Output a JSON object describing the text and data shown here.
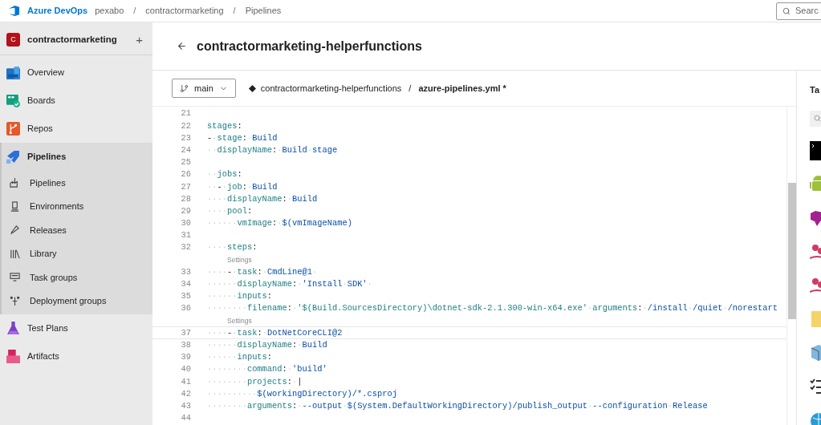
{
  "top_bar": {
    "brand": "Azure DevOps",
    "breadcrumbs": [
      "pexabo",
      "contractormarketing",
      "Pipelines"
    ],
    "separator": "/",
    "search": {
      "placeholder": "Searc"
    }
  },
  "sidebar": {
    "project": {
      "initial": "C",
      "name": "contractormarketing",
      "add": "+"
    },
    "items": [
      {
        "label": "Overview",
        "selected": false
      },
      {
        "label": "Boards",
        "selected": false
      },
      {
        "label": "Repos",
        "selected": false
      },
      {
        "label": "Pipelines",
        "selected": true,
        "expanded": true,
        "children": [
          {
            "label": "Pipelines"
          },
          {
            "label": "Environments"
          },
          {
            "label": "Releases"
          },
          {
            "label": "Library"
          },
          {
            "label": "Task groups"
          },
          {
            "label": "Deployment groups"
          }
        ]
      },
      {
        "label": "Test Plans",
        "selected": false
      },
      {
        "label": "Artifacts",
        "selected": false
      }
    ]
  },
  "page": {
    "title": "contractormarketing-helperfunctions",
    "branch": "main",
    "repo": "contractormarketing-helperfunctions",
    "separator": "/",
    "file": "azure-pipelines.yml *"
  },
  "editor": {
    "lines": [
      {
        "number": "21"
      },
      {
        "number": "22",
        "tokens": [
          {
            "kind": "key",
            "text": "stages"
          },
          {
            "kind": "punct",
            "text": ":"
          }
        ]
      },
      {
        "number": "23",
        "tokens": [
          {
            "kind": "punct",
            "text": "-"
          },
          {
            "kind": "ws",
            "text": "·"
          },
          {
            "kind": "key",
            "text": "stage"
          },
          {
            "kind": "punct",
            "text": ":"
          },
          {
            "kind": "ws",
            "text": "·"
          },
          {
            "kind": "val",
            "text": "Build"
          }
        ]
      },
      {
        "number": "24",
        "tokens": [
          {
            "kind": "ws",
            "text": "··"
          },
          {
            "kind": "key",
            "text": "displayName"
          },
          {
            "kind": "punct",
            "text": ":"
          },
          {
            "kind": "ws",
            "text": "·"
          },
          {
            "kind": "val",
            "text": "Build"
          },
          {
            "kind": "ws",
            "text": "·"
          },
          {
            "kind": "val",
            "text": "stage"
          }
        ]
      },
      {
        "number": "25"
      },
      {
        "number": "26",
        "tokens": [
          {
            "kind": "ws",
            "text": "··"
          },
          {
            "kind": "key",
            "text": "jobs"
          },
          {
            "kind": "punct",
            "text": ":"
          }
        ]
      },
      {
        "number": "27",
        "tokens": [
          {
            "kind": "ws",
            "text": "··"
          },
          {
            "kind": "punct",
            "text": "-"
          },
          {
            "kind": "ws",
            "text": "·"
          },
          {
            "kind": "key",
            "text": "job"
          },
          {
            "kind": "punct",
            "text": ":"
          },
          {
            "kind": "ws",
            "text": "·"
          },
          {
            "kind": "val",
            "text": "Build"
          }
        ]
      },
      {
        "number": "28",
        "tokens": [
          {
            "kind": "ws",
            "text": "····"
          },
          {
            "kind": "key",
            "text": "displayName"
          },
          {
            "kind": "punct",
            "text": ":"
          },
          {
            "kind": "ws",
            "text": "·"
          },
          {
            "kind": "val",
            "text": "Build"
          }
        ]
      },
      {
        "number": "29",
        "tokens": [
          {
            "kind": "ws",
            "text": "····"
          },
          {
            "kind": "key",
            "text": "pool"
          },
          {
            "kind": "punct",
            "text": ":"
          }
        ]
      },
      {
        "number": "30",
        "tokens": [
          {
            "kind": "ws",
            "text": "······"
          },
          {
            "kind": "key",
            "text": "vmImage"
          },
          {
            "kind": "punct",
            "text": ":"
          },
          {
            "kind": "ws",
            "text": "·"
          },
          {
            "kind": "val",
            "text": "$(vmImageName)"
          }
        ]
      },
      {
        "number": "31"
      },
      {
        "number": "32",
        "tokens": [
          {
            "kind": "ws",
            "text": "····"
          },
          {
            "kind": "key",
            "text": "steps"
          },
          {
            "kind": "punct",
            "text": ":"
          }
        ]
      },
      {
        "kind": "codelens",
        "text": "Settings"
      },
      {
        "number": "33",
        "tokens": [
          {
            "kind": "ws",
            "text": "····"
          },
          {
            "kind": "punct",
            "text": "-"
          },
          {
            "kind": "ws",
            "text": "·"
          },
          {
            "kind": "key",
            "text": "task"
          },
          {
            "kind": "punct",
            "text": ":"
          },
          {
            "kind": "ws",
            "text": "·"
          },
          {
            "kind": "val",
            "text": "CmdLine@1"
          },
          {
            "kind": "ws",
            "text": "·"
          }
        ]
      },
      {
        "number": "34",
        "tokens": [
          {
            "kind": "ws",
            "text": "······"
          },
          {
            "kind": "key",
            "text": "displayName"
          },
          {
            "kind": "punct",
            "text": ":"
          },
          {
            "kind": "ws",
            "text": "·"
          },
          {
            "kind": "val",
            "text": "'Install"
          },
          {
            "kind": "ws",
            "text": "·"
          },
          {
            "kind": "val",
            "text": "SDK'"
          },
          {
            "kind": "ws",
            "text": "·"
          }
        ]
      },
      {
        "number": "35",
        "tokens": [
          {
            "kind": "ws",
            "text": "······"
          },
          {
            "kind": "key",
            "text": "inputs"
          },
          {
            "kind": "punct",
            "text": ":"
          }
        ]
      },
      {
        "number": "36",
        "tokens": [
          {
            "kind": "ws",
            "text": "········"
          },
          {
            "kind": "key",
            "text": "filename"
          },
          {
            "kind": "punct",
            "text": ":"
          },
          {
            "kind": "ws",
            "text": "·"
          },
          {
            "kind": "str",
            "text": "'$(Build.SourcesDirectory)\\dotnet-sdk-2.1.300-win-x64.exe'"
          },
          {
            "kind": "ws",
            "text": "·"
          },
          {
            "kind": "key",
            "text": "arguments"
          },
          {
            "kind": "punct",
            "text": ":"
          },
          {
            "kind": "ws",
            "text": "·"
          },
          {
            "kind": "val",
            "text": "/install"
          },
          {
            "kind": "ws",
            "text": "·"
          },
          {
            "kind": "val",
            "text": "/quiet"
          },
          {
            "kind": "ws",
            "text": "·"
          },
          {
            "kind": "val",
            "text": "/norestart"
          }
        ]
      },
      {
        "kind": "codelens",
        "text": "Settings"
      },
      {
        "number": "37",
        "current": true,
        "tokens": [
          {
            "kind": "ws",
            "text": "····"
          },
          {
            "kind": "punct",
            "text": "-"
          },
          {
            "kind": "ws",
            "text": "·"
          },
          {
            "kind": "key",
            "text": "task"
          },
          {
            "kind": "punct",
            "text": ":"
          },
          {
            "kind": "ws",
            "text": "·"
          },
          {
            "kind": "val",
            "text": "DotNetCoreCLI@2"
          }
        ]
      },
      {
        "number": "38",
        "tokens": [
          {
            "kind": "ws",
            "text": "······"
          },
          {
            "kind": "key",
            "text": "displayName"
          },
          {
            "kind": "punct",
            "text": ":"
          },
          {
            "kind": "ws",
            "text": "·"
          },
          {
            "kind": "val",
            "text": "Build"
          }
        ]
      },
      {
        "number": "39",
        "tokens": [
          {
            "kind": "ws",
            "text": "······"
          },
          {
            "kind": "key",
            "text": "inputs"
          },
          {
            "kind": "punct",
            "text": ":"
          }
        ]
      },
      {
        "number": "40",
        "tokens": [
          {
            "kind": "ws",
            "text": "········"
          },
          {
            "kind": "key",
            "text": "command"
          },
          {
            "kind": "punct",
            "text": ":"
          },
          {
            "kind": "ws",
            "text": "·"
          },
          {
            "kind": "val",
            "text": "'build'"
          }
        ]
      },
      {
        "number": "41",
        "tokens": [
          {
            "kind": "ws",
            "text": "········"
          },
          {
            "kind": "key",
            "text": "projects"
          },
          {
            "kind": "punct",
            "text": ":"
          },
          {
            "kind": "ws",
            "text": "·"
          },
          {
            "kind": "punct",
            "text": "|"
          }
        ]
      },
      {
        "number": "42",
        "tokens": [
          {
            "kind": "ws",
            "text": "··········"
          },
          {
            "kind": "val",
            "text": "$(workingDirectory)/*.csproj"
          }
        ]
      },
      {
        "number": "43",
        "tokens": [
          {
            "kind": "ws",
            "text": "········"
          },
          {
            "kind": "key",
            "text": "arguments"
          },
          {
            "kind": "punct",
            "text": ":"
          },
          {
            "kind": "ws",
            "text": "·"
          },
          {
            "kind": "val",
            "text": "--output"
          },
          {
            "kind": "ws",
            "text": "·"
          },
          {
            "kind": "val",
            "text": "$(System.DefaultWorkingDirectory)/publish_output"
          },
          {
            "kind": "ws",
            "text": "·"
          },
          {
            "kind": "val",
            "text": "--configuration"
          },
          {
            "kind": "ws",
            "text": "·"
          },
          {
            "kind": "val",
            "text": "Release"
          }
        ]
      },
      {
        "number": "44"
      }
    ]
  },
  "tasks_panel": {
    "title": "Ta"
  }
}
